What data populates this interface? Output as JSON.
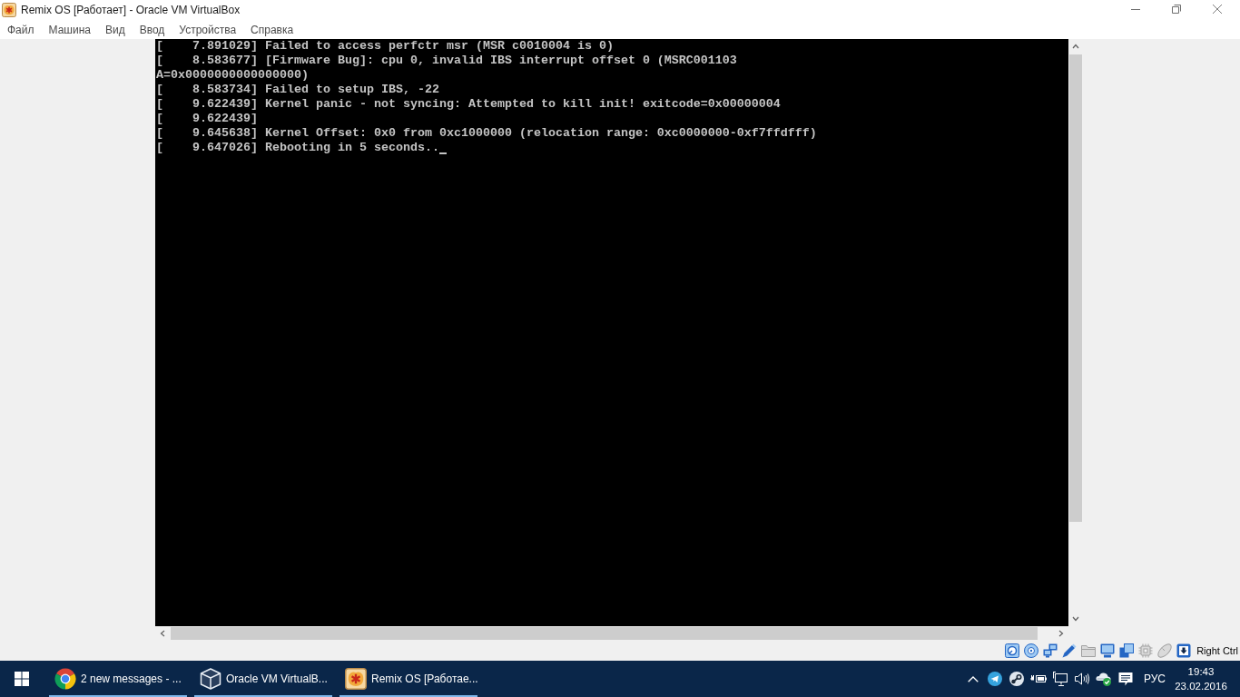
{
  "window": {
    "title": "Remix OS [Работает] - Oracle VM VirtualBox"
  },
  "menu": [
    "Файл",
    "Машина",
    "Вид",
    "Ввод",
    "Устройства",
    "Справка"
  ],
  "console": {
    "lines": [
      "[    7.891029] Failed to access perfctr msr (MSR c0010004 is 0)",
      "[    8.583677] [Firmware Bug]: cpu 0, invalid IBS interrupt offset 0 (MSRC001103",
      "A=0x0000000000000000)",
      "[    8.583734] Failed to setup IBS, -22",
      "[    9.622439] Kernel panic - not syncing: Attempted to kill init! exitcode=0x00000004",
      "[    9.622439]",
      "[    9.645638] Kernel Offset: 0x0 from 0xc1000000 (relocation range: 0xc0000000-0xf7ffdfff)",
      "[    9.647026] Rebooting in 5 seconds.."
    ],
    "cursor": true
  },
  "status_bar": {
    "indicators": [
      {
        "kind": "harddisk",
        "active": true
      },
      {
        "kind": "optical",
        "active": true
      },
      {
        "kind": "network",
        "active": true
      },
      {
        "kind": "usb",
        "active": true
      },
      {
        "kind": "folders",
        "active": false
      },
      {
        "kind": "display",
        "active": true
      },
      {
        "kind": "capture",
        "active": true
      },
      {
        "kind": "cpu",
        "active": false
      },
      {
        "kind": "mouse",
        "active": false
      },
      {
        "kind": "keyboard",
        "active": true
      }
    ],
    "host_key": "Right Ctrl"
  },
  "taskbar": {
    "tasks": [
      {
        "kind": "browser",
        "label": "2 new messages - ..."
      },
      {
        "kind": "virtualbox",
        "label": "Oracle VM VirtualB..."
      },
      {
        "kind": "vm",
        "label": "Remix OS [Работае..."
      }
    ],
    "language": "РУС",
    "time": "19:43",
    "date": "23.02.2016"
  }
}
